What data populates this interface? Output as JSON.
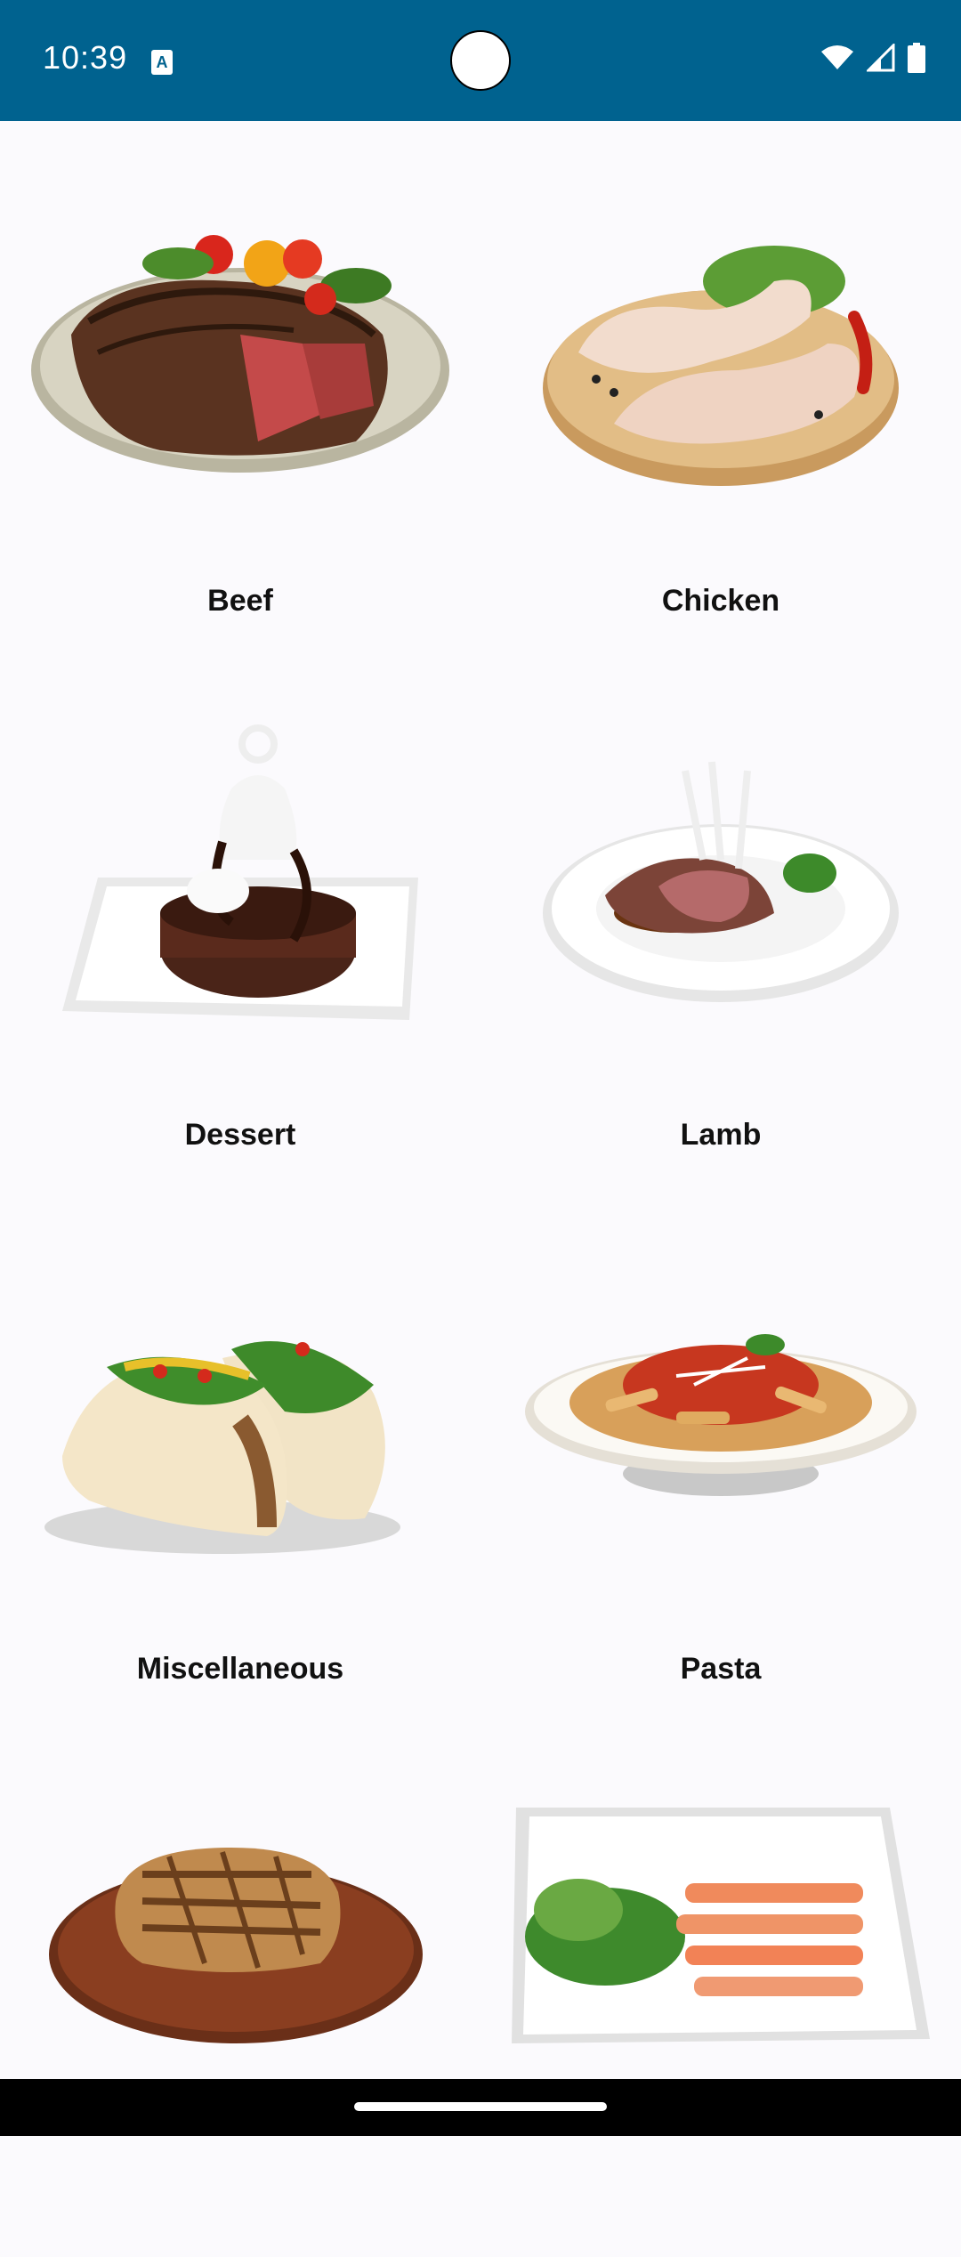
{
  "status_bar": {
    "time": "10:39",
    "indicator": "A"
  },
  "categories": [
    {
      "label": "Beef",
      "icon": "beef-steak-image"
    },
    {
      "label": "Chicken",
      "icon": "chicken-legs-image"
    },
    {
      "label": "Dessert",
      "icon": "chocolate-cake-image"
    },
    {
      "label": "Lamb",
      "icon": "lamb-chops-image"
    },
    {
      "label": "Miscellaneous",
      "icon": "tacos-image"
    },
    {
      "label": "Pasta",
      "icon": "penne-pasta-image"
    },
    {
      "label": "",
      "icon": "pork-chop-image"
    },
    {
      "label": "",
      "icon": "salmon-plate-image"
    }
  ]
}
